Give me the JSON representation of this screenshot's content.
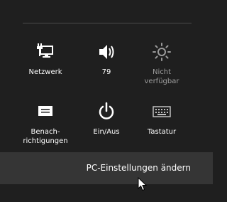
{
  "tiles": {
    "network": {
      "label": "Netzwerk",
      "icon": "network-icon"
    },
    "volume": {
      "label": "79",
      "icon": "volume-icon"
    },
    "brightness": {
      "label": "Nicht verfügbar",
      "icon": "brightness-icon",
      "enabled": false
    },
    "notifications": {
      "label": "Benach-richtigungen",
      "icon": "notifications-icon"
    },
    "power": {
      "label": "Ein/Aus",
      "icon": "power-icon"
    },
    "keyboard": {
      "label": "Tastatur",
      "icon": "keyboard-icon"
    }
  },
  "footer": {
    "label": "PC-Einstellungen ändern"
  },
  "colors": {
    "background": "#1f1f1f",
    "footer_background": "#353535",
    "text": "#ffffff"
  }
}
